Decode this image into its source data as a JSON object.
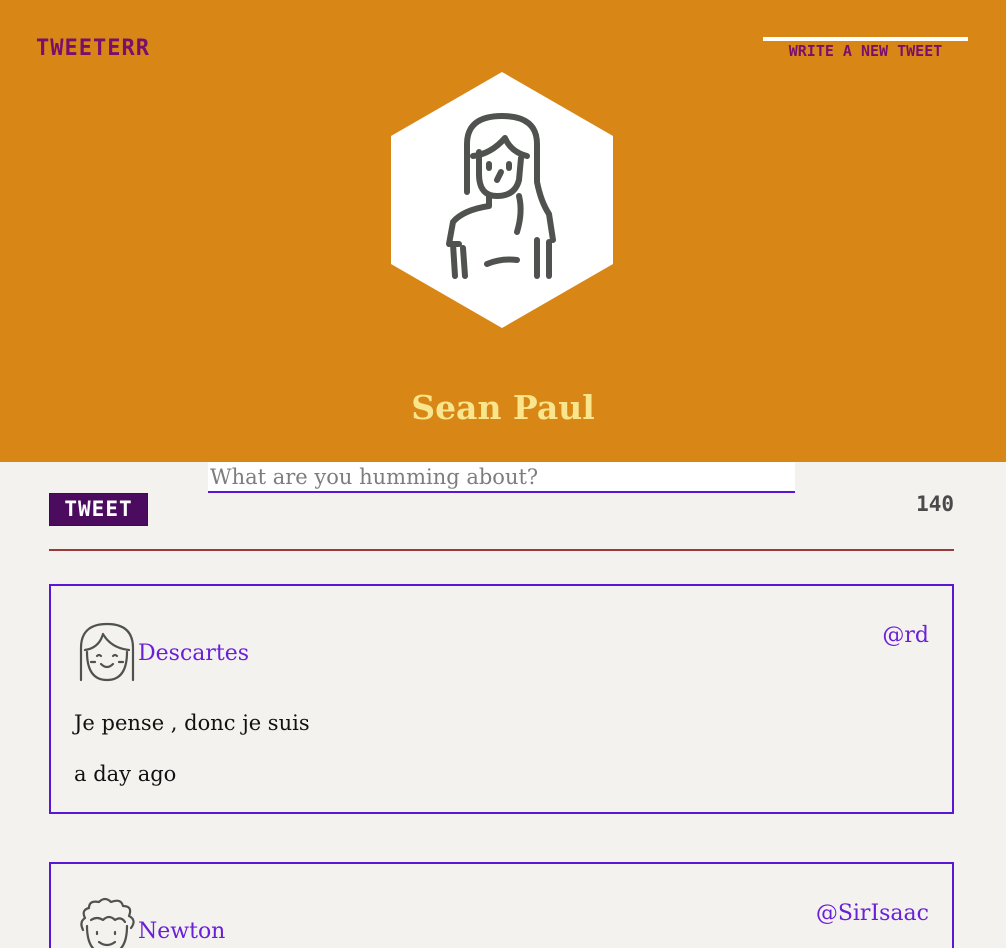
{
  "header": {
    "brand": "TWEETERR",
    "write_button": "WRITE A NEW TWEET",
    "profile_name": "Sean Paul",
    "background_color": "#d88716"
  },
  "compose": {
    "placeholder": "What are you humming about?",
    "tweet_button": "TWEET",
    "char_count": "140"
  },
  "tweets": [
    {
      "name": "Descartes",
      "handle": "@rd",
      "text": "Je pense , donc je suis",
      "time": "a day ago",
      "avatar_icon": "girl-face-icon"
    },
    {
      "name": "Newton",
      "handle": "@SirIsaac",
      "avatar_icon": "curly-hair-face-icon"
    }
  ],
  "colors": {
    "accent": "#5a16d6",
    "brand": "#7a0f6a",
    "name": "#f8e58c"
  }
}
